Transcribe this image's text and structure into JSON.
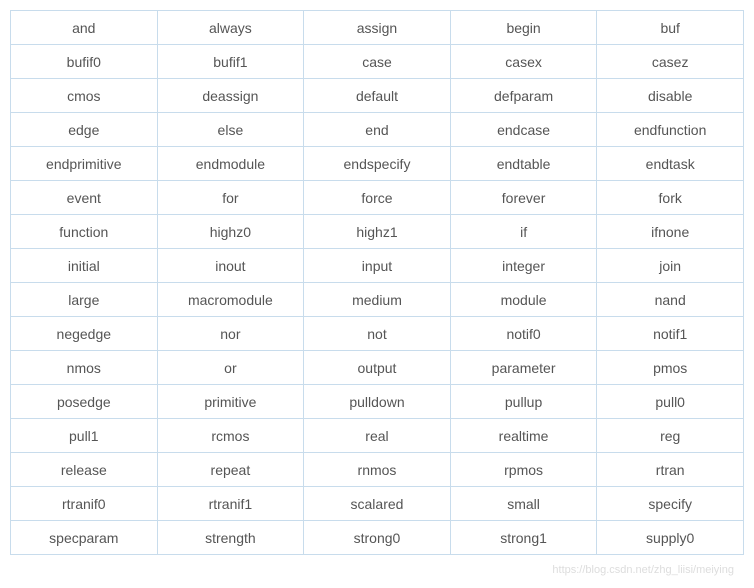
{
  "table": {
    "rows": [
      [
        "and",
        "always",
        "assign",
        "begin",
        "buf"
      ],
      [
        "bufif0",
        "bufif1",
        "case",
        "casex",
        "casez"
      ],
      [
        "cmos",
        "deassign",
        "default",
        "defparam",
        "disable"
      ],
      [
        "edge",
        "else",
        "end",
        "endcase",
        "endfunction"
      ],
      [
        "endprimitive",
        "endmodule",
        "endspecify",
        "endtable",
        "endtask"
      ],
      [
        "event",
        "for",
        "force",
        "forever",
        "fork"
      ],
      [
        "function",
        "highz0",
        "highz1",
        "if",
        "ifnone"
      ],
      [
        "initial",
        "inout",
        "input",
        "integer",
        "join"
      ],
      [
        "large",
        "macromodule",
        "medium",
        "module",
        "nand"
      ],
      [
        "negedge",
        "nor",
        "not",
        "notif0",
        "notif1"
      ],
      [
        "nmos",
        "or",
        "output",
        "parameter",
        "pmos"
      ],
      [
        "posedge",
        "primitive",
        "pulldown",
        "pullup",
        "pull0"
      ],
      [
        "pull1",
        "rcmos",
        "real",
        "realtime",
        "reg"
      ],
      [
        "release",
        "repeat",
        "rnmos",
        "rpmos",
        "rtran"
      ],
      [
        "rtranif0",
        "rtranif1",
        "scalared",
        "small",
        "specify"
      ],
      [
        "specparam",
        "strength",
        "strong0",
        "strong1",
        "supply0"
      ]
    ]
  },
  "watermark": "https://blog.csdn.net/zhg_liisi/meiying"
}
